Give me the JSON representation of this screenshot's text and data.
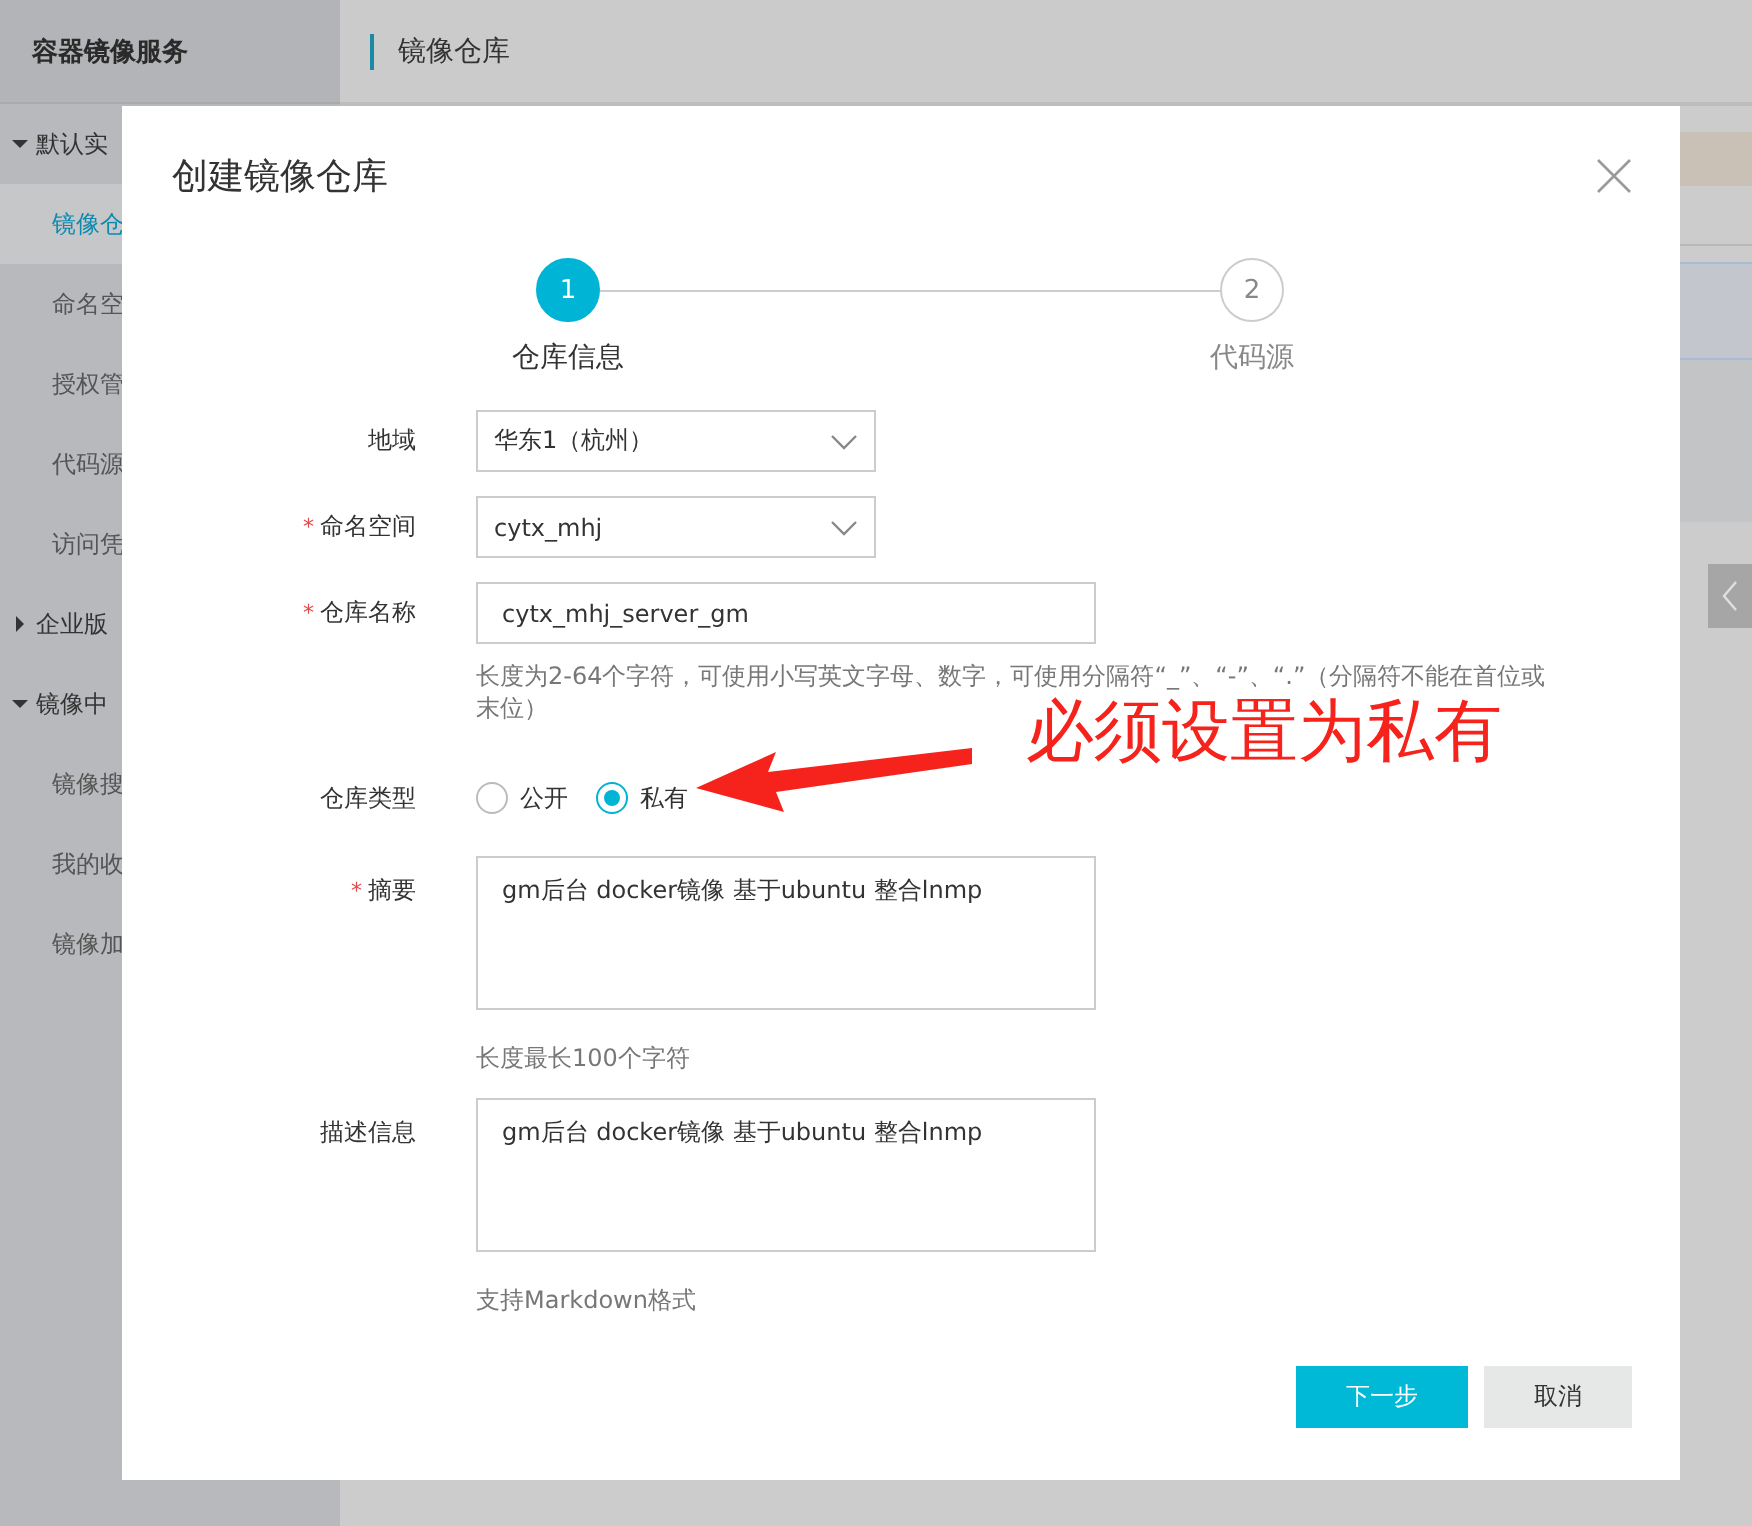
{
  "app": {
    "title": "容器镜像服务"
  },
  "header": {
    "title": "镜像仓库"
  },
  "sidebar": {
    "groups": [
      {
        "label": "默认实",
        "expanded": true,
        "items": [
          {
            "label": "镜像仓",
            "selected": true
          },
          {
            "label": "命名空",
            "selected": false
          },
          {
            "label": "授权管",
            "selected": false
          },
          {
            "label": "代码源",
            "selected": false
          },
          {
            "label": "访问凭",
            "selected": false
          }
        ]
      },
      {
        "label": "企业版",
        "expanded": false
      },
      {
        "label": "镜像中",
        "expanded": true,
        "items": [
          {
            "label": "镜像搜",
            "selected": false
          },
          {
            "label": "我的收",
            "selected": false
          },
          {
            "label": "镜像加",
            "selected": false
          }
        ]
      }
    ]
  },
  "dialog": {
    "title": "创建镜像仓库",
    "steps": [
      {
        "number": "1",
        "label": "仓库信息",
        "selected": true
      },
      {
        "number": "2",
        "label": "代码源",
        "selected": false
      }
    ],
    "fields": [
      {
        "kind": "select",
        "label": "地域",
        "value": "华东1（杭州）"
      },
      {
        "kind": "select",
        "label": "命名空间",
        "required_mark": "*",
        "value": "cytx_mhj"
      },
      {
        "kind": "input",
        "label": "仓库名称",
        "required_mark": "*",
        "value": "cytx_mhj_server_gm",
        "hint": "长度为2-64个字符，可使用小写英文字母、数字，可使用分隔符“_”、“-”、“.”（分隔符不能在首位或末位）"
      },
      {
        "kind": "radio",
        "label": "仓库类型",
        "options": [
          {
            "label": "公开",
            "selected": false
          },
          {
            "label": "私有",
            "selected": true
          }
        ]
      },
      {
        "kind": "textarea",
        "label": "摘要",
        "required_mark": "*",
        "value": "gm后台 docker镜像 基于ubuntu 整合lnmp",
        "hint": "长度最长100个字符"
      },
      {
        "kind": "textarea",
        "label": "描述信息",
        "value": "gm后台 docker镜像 基于ubuntu 整合lnmp",
        "hint": "支持Markdown格式"
      }
    ],
    "buttons": [
      {
        "label": "下一步",
        "kind": "primary"
      },
      {
        "label": "取消",
        "kind": "secondary"
      }
    ]
  },
  "annotation": {
    "text": "必须设置为私有"
  }
}
